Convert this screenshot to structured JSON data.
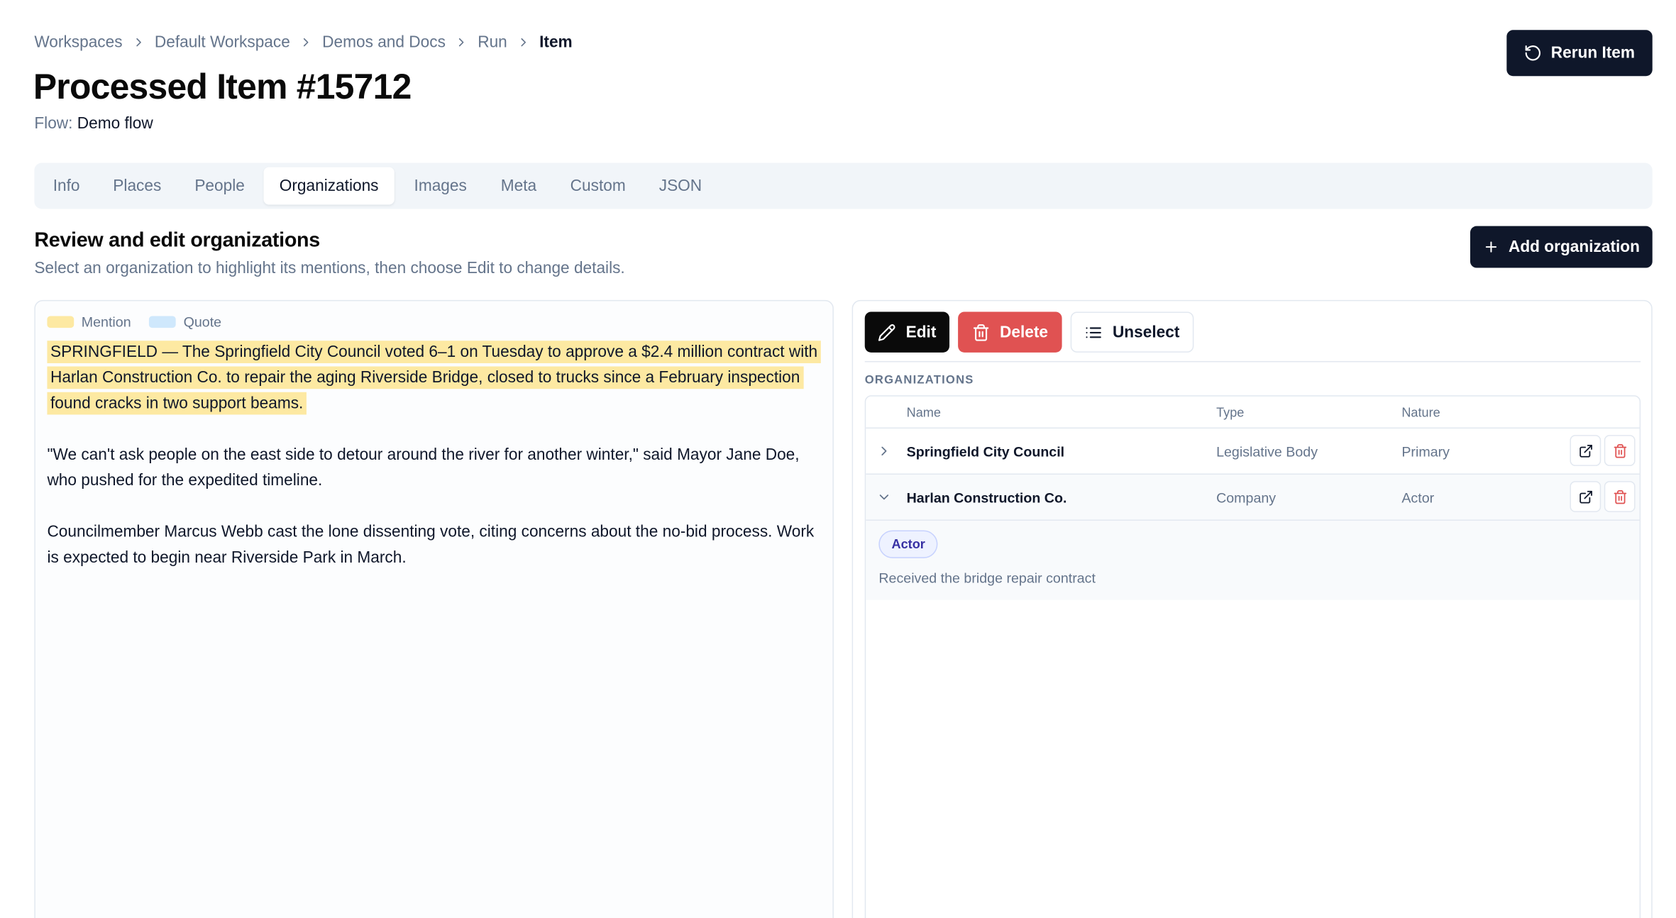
{
  "breadcrumb": [
    "Workspaces",
    "Default Workspace",
    "Demos and Docs",
    "Run",
    "Item"
  ],
  "header": {
    "title": "Processed Item #15712",
    "flow_label": "Flow:",
    "flow_value": "Demo flow",
    "rerun_label": "Rerun Item"
  },
  "tabs": {
    "active": "Organizations",
    "items": [
      "Info",
      "Places",
      "People",
      "Organizations",
      "Images",
      "Meta",
      "Custom",
      "JSON"
    ]
  },
  "section": {
    "title": "Review and edit organizations",
    "subtitle": "Select an organization to highlight its mentions, then choose Edit to change details.",
    "add_label": "Add organization"
  },
  "legend": {
    "mention_label": "Mention",
    "mention_color": "#fde9a2",
    "quote_label": "Quote",
    "quote_color": "#cfe8fc"
  },
  "article": {
    "paragraph1": "SPRINGFIELD — The Springfield City Council voted 6–1 on Tuesday to approve a $2.4 million contract with Harlan Construction Co. to repair the aging Riverside Bridge, closed to trucks since a February inspection found cracks in two support beams.",
    "paragraph2": "\"We can't ask people on the east side to detour around the river for another winter,\" said Mayor Jane Doe, who pushed for the expedited timeline.",
    "paragraph3": "Councilmember Marcus Webb cast the lone dissenting vote, citing concerns about the no-bid process. Work is expected to begin near Riverside Park in March."
  },
  "actions": {
    "edit_label": "Edit",
    "delete_label": "Delete",
    "unselect_label": "Unselect"
  },
  "organizations": {
    "heading": "ORGANIZATIONS",
    "columns": {
      "name": "Name",
      "type": "Type",
      "nature": "Nature"
    },
    "rows": [
      {
        "name": "Springfield City Council",
        "type": "Legislative Body",
        "nature": "Primary",
        "expanded": false
      },
      {
        "name": "Harlan Construction Co.",
        "type": "Company",
        "nature": "Actor",
        "expanded": true
      }
    ],
    "expanded_detail": {
      "badge": "Actor",
      "description": "Received the bridge repair contract"
    }
  },
  "colors": {
    "primary_dark": "#0f172a",
    "danger": "#e05252",
    "muted_text": "#64748b",
    "border": "#e2e8f0"
  }
}
